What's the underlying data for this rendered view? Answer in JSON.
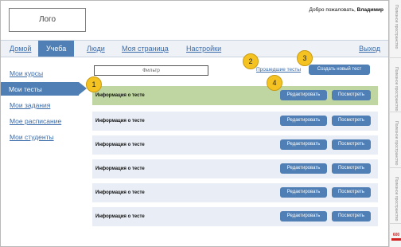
{
  "header": {
    "logo": "Лого",
    "welcome_prefix": "Добро пожаловать, ",
    "user_name": "Владимир"
  },
  "nav": {
    "items": [
      "Домой",
      "Учеба",
      "Люди",
      "Моя страница",
      "Настройки"
    ],
    "active": "Учеба",
    "logout": "Выход"
  },
  "sidebar": {
    "items": [
      "Мои курсы",
      "Мои тесты",
      "Мои задания",
      "Мое расписание",
      "Мои студенты"
    ],
    "active": "Мои тесты"
  },
  "toolbar": {
    "filter_placeholder": "Фильтр",
    "past_tests_link": "Прошедшие тесты",
    "create_button": "Создать новый тест"
  },
  "tests": {
    "rows": [
      {
        "title": "Информация о тесте",
        "edit": "Редактировать",
        "view": "Посмотреть",
        "selected": true
      },
      {
        "title": "Информация о тесте",
        "edit": "Редактировать",
        "view": "Посмотреть",
        "selected": false
      },
      {
        "title": "Информация о тесте",
        "edit": "Редактировать",
        "view": "Посмотреть",
        "selected": false
      },
      {
        "title": "Информация о тесте",
        "edit": "Редактировать",
        "view": "Посмотреть",
        "selected": false
      },
      {
        "title": "Информация о тесте",
        "edit": "Редактировать",
        "view": "Посмотреть",
        "selected": false
      },
      {
        "title": "Информация о тесте",
        "edit": "Редактировать",
        "view": "Посмотреть",
        "selected": false
      }
    ]
  },
  "markers": [
    "1",
    "2",
    "3",
    "4"
  ],
  "margin": {
    "labels": [
      "Полезное пространство",
      "Полезное пространство",
      "Полезное пространство",
      "Полезное пространство"
    ],
    "page_number": "600"
  },
  "colors": {
    "accent": "#4f7fb4",
    "row_bg": "#e9eef6",
    "row_selected": "#bfd6a2",
    "marker": "#f4c322",
    "link": "#3a6aa8"
  }
}
